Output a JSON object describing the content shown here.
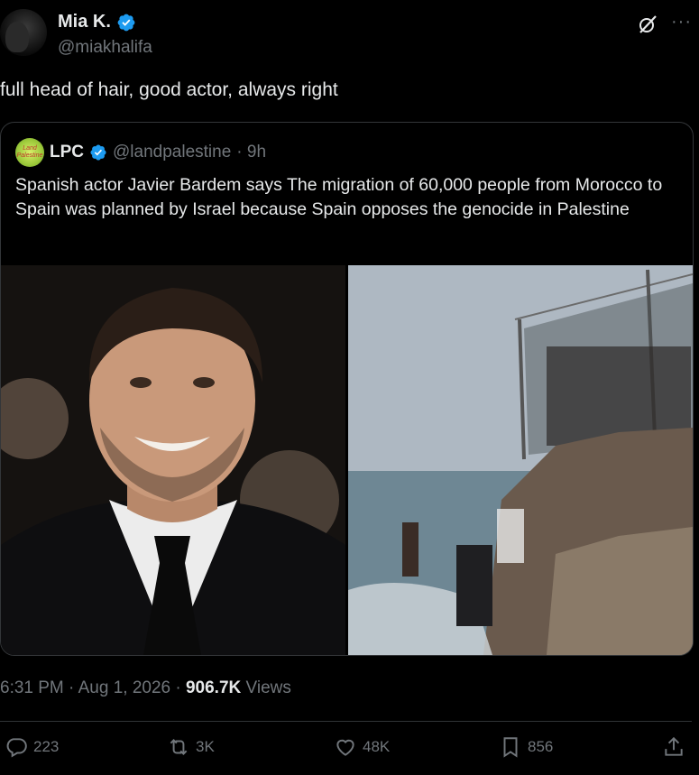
{
  "author": {
    "name": "Mia K.",
    "handle": "@miakhalifa",
    "verified": true
  },
  "tweet": {
    "text": "full head of hair, good actor, always right"
  },
  "quoted": {
    "logo_text": "Land Palestine",
    "name": "LPC",
    "handle": "@landpalestine",
    "time": "· 9h",
    "text": "Spanish actor Javier Bardem says The migration of 60,000 people from Morocco to Spain was planned by Israel because Spain opposes the genocide in Palestine",
    "images": [
      "Javier Bardem portrait",
      "Migrants climbing rocks near border fence by the sea"
    ]
  },
  "meta": {
    "time": "6:31 PM",
    "sep1": " · ",
    "date": "Aug 1, 2026",
    "sep2": " · ",
    "views_count": "906.7K",
    "views_label": " Views"
  },
  "actions": {
    "replies": "223",
    "reposts": "3K",
    "likes": "48K",
    "bookmarks": "856"
  },
  "colors": {
    "accent": "#1d9bf0",
    "muted": "#71767b",
    "text": "#e7e9ea",
    "background": "#000000"
  },
  "icons": [
    "grok-icon",
    "more-icon",
    "verified-icon",
    "reply-icon",
    "repost-icon",
    "like-icon",
    "bookmark-icon",
    "share-icon"
  ]
}
